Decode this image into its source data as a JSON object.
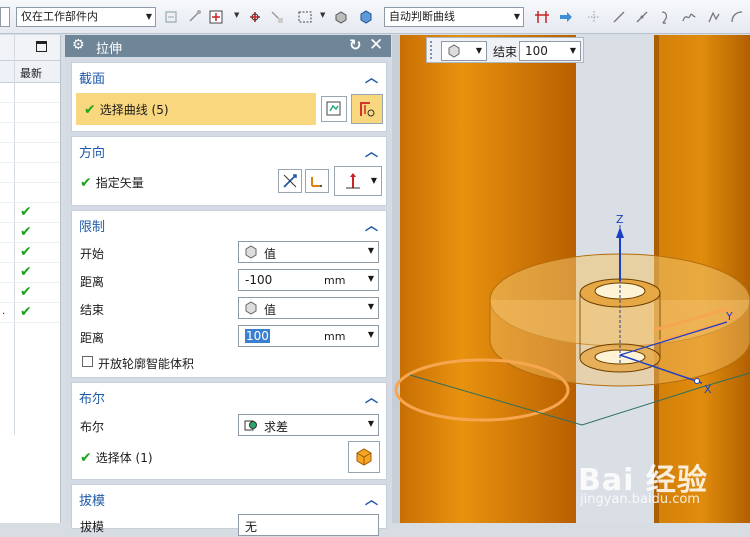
{
  "toolbar": {
    "filter_value": "",
    "scope_value": "仅在工作部件内",
    "curve_rule_value": "自动判断曲线"
  },
  "navigator": {
    "column_label": "最新",
    "rows": [
      {
        "check": "",
        "dot": ""
      },
      {
        "check": "",
        "dot": ""
      },
      {
        "check": "",
        "dot": ""
      },
      {
        "check": "",
        "dot": ""
      },
      {
        "check": "",
        "dot": ""
      },
      {
        "check": "",
        "dot": ""
      },
      {
        "check": "✔",
        "dot": ""
      },
      {
        "check": "✔",
        "dot": ""
      },
      {
        "check": "✔",
        "dot": ""
      },
      {
        "check": "✔",
        "dot": ""
      },
      {
        "check": "✔",
        "dot": ""
      },
      {
        "check": "✔",
        "dot": "."
      }
    ]
  },
  "dialog": {
    "title": "拉伸",
    "sections": {
      "section": {
        "title": "截面",
        "select_curve_label": "选择曲线 (5)"
      },
      "direction": {
        "title": "方向",
        "specify_vector_label": "指定矢量"
      },
      "limits": {
        "title": "限制",
        "start_label": "开始",
        "start_value": "值",
        "start_distance_label": "距离",
        "start_distance_value": "-100",
        "start_unit": "mm",
        "end_label": "结束",
        "end_value": "值",
        "end_distance_label": "距离",
        "end_distance_value": "100",
        "end_unit": "mm",
        "open_profile_label": "开放轮廓智能体积"
      },
      "boolean": {
        "title": "布尔",
        "boolean_label": "布尔",
        "boolean_value": "求差",
        "select_body_label": "选择体 (1)"
      },
      "draft": {
        "title": "拔模",
        "draft_label": "拔模",
        "draft_value": "无"
      }
    }
  },
  "viewport": {
    "float_end_label": "结束",
    "float_end_value": "100",
    "axis_labels": {
      "z": "Z",
      "x": "X",
      "y": "Y"
    },
    "watermark": "Bai 经验",
    "watermark_url": "jingyan.baidu.com"
  },
  "colors": {
    "accent_blue": "#1f5aa8",
    "selection_yellow": "#f9d77e",
    "part_orange": "#d8820a",
    "check_green": "#1ca51c"
  }
}
